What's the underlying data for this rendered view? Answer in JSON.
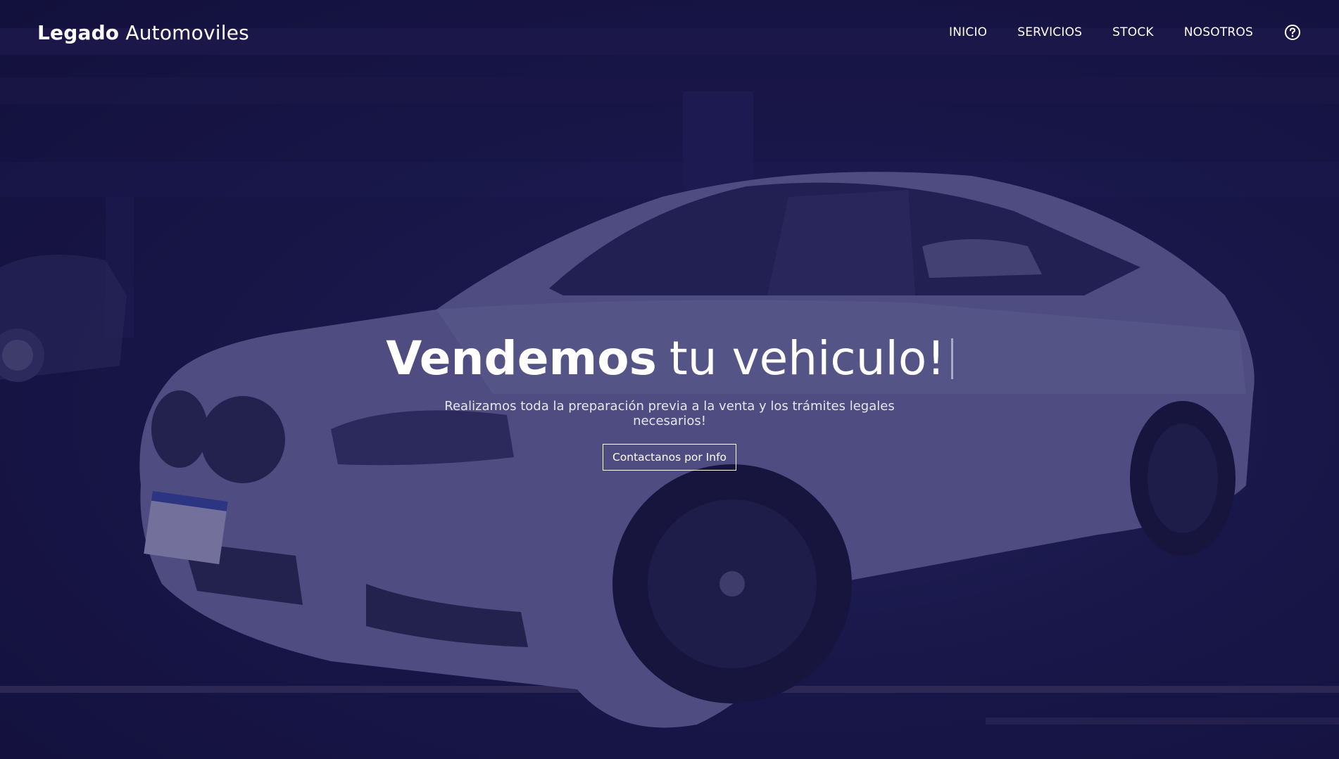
{
  "brand": {
    "bold": "Legado",
    "light": "Automoviles"
  },
  "nav": {
    "items": [
      {
        "label": "INICIO"
      },
      {
        "label": "SERVICIOS"
      },
      {
        "label": "STOCK"
      },
      {
        "label": "NOSOTROS"
      }
    ],
    "help_icon": "question-circle-icon"
  },
  "hero": {
    "headline_bold": "Vendemos",
    "headline_regular": "tu vehiculo!",
    "subtitle": "Realizamos toda la preparación previa a la venta y los trámites legales necesarios!",
    "cta_label": "Contactanos por Info"
  },
  "colors": {
    "overlay": "#141238",
    "text": "#ffffff"
  }
}
